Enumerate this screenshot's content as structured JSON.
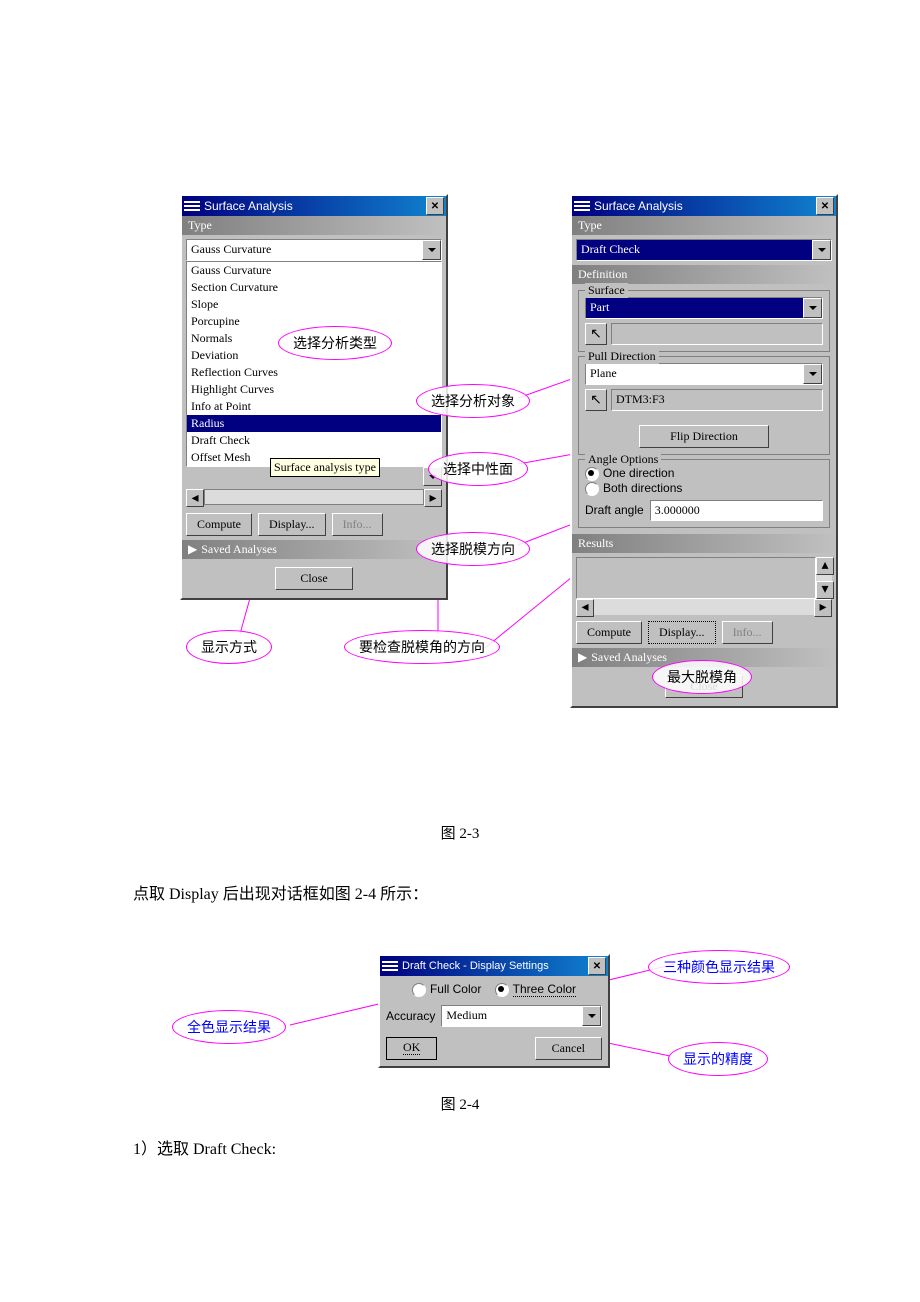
{
  "win1": {
    "title": "Surface Analysis",
    "type_label": "Type",
    "selected": "Gauss Curvature",
    "items": [
      "Gauss Curvature",
      "Section Curvature",
      "Slope",
      "Porcupine",
      "Normals",
      "Deviation",
      "Reflection Curves",
      "Highlight Curves",
      "Info at Point",
      "Radius",
      "Draft Check",
      "Offset Mesh"
    ],
    "selected_index": 9,
    "tooltip": "Surface analysis type",
    "compute": "Compute",
    "display": "Display...",
    "info": "Info...",
    "saved": "Saved Analyses",
    "close": "Close"
  },
  "win2": {
    "title": "Surface Analysis",
    "type_label": "Type",
    "type_value": "Draft Check",
    "definition": "Definition",
    "surface_label": "Surface",
    "surface_value": "Part",
    "pull_label": "Pull Direction",
    "pull_value": "Plane",
    "pull_ref": "DTM3:F3",
    "flip": "Flip Direction",
    "angle_label": "Angle Options",
    "one_dir": "One direction",
    "both_dir": "Both directions",
    "draft_angle_label": "Draft angle",
    "draft_angle_value": "3.000000",
    "results": "Results",
    "compute": "Compute",
    "display": "Display...",
    "info": "Info...",
    "saved": "Saved Analyses",
    "close": "Close"
  },
  "win3": {
    "title": "Draft Check - Display Settings",
    "full_color": "Full Color",
    "three_color": "Three Color",
    "accuracy_label": "Accuracy",
    "accuracy_value": "Medium",
    "ok": "OK",
    "cancel": "Cancel"
  },
  "annotations": {
    "a1": "选择分析类型",
    "a2": "选择分析对象",
    "a3": "选择中性面",
    "a4": "选择脱模方向",
    "a5": "显示方式",
    "a6": "要检查脱模角的方向",
    "a7": "最大脱模角",
    "a8": "三种颜色显示结果",
    "a9": "全色显示结果",
    "a10": "显示的精度"
  },
  "body": {
    "fig23": "图 2-3",
    "para1": "点取 Display 后出现对话框如图 2-4 所示：",
    "fig24": "图 2-4",
    "step1": "1）选取 Draft Check:"
  }
}
